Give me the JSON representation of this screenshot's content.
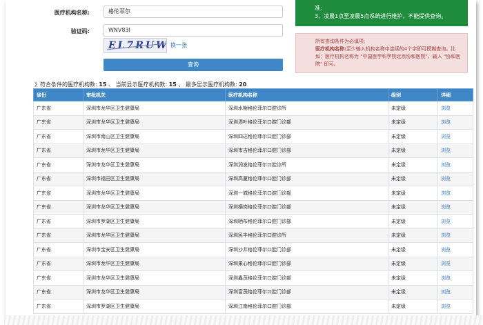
{
  "form": {
    "name_label": "医疗机构名称:",
    "name_value": "格伦菲尔",
    "code_label": "验证码:",
    "code_value": "WNV83I",
    "captcha_text": "EL7RUW",
    "refresh_label": "换一张",
    "query_label": "查询"
  },
  "notices": {
    "green_line1": "准;",
    "green_line2": "3、凌晨1点至凌晨5点系统进行维护，不能提供查询。",
    "red_line1": "所有查询条件为必填项;",
    "red_bold": "医疗机构名称:",
    "red_line2": "至少输入机构名称中连续的4个字即可模糊查询。比如：医疗机构名称为 \"中国医学科学院北京协和医院\"，输入 \"协和医院\" 即可。"
  },
  "summary": {
    "prefix": "》符合条件的医疗机构数:",
    "matched": "15",
    "mid": "、 当前显示医疗机构数:",
    "shown": "15",
    "mid2": "、 最多显示医疗机构数:",
    "max": "20"
  },
  "table": {
    "headers": [
      "省份",
      "审批机关",
      "医疗机构名称",
      "级别",
      "详细"
    ],
    "rows": [
      [
        "广东省",
        "深圳市龙华区卫生健康局",
        "深圳水榭格伦菲尔口腔诊所",
        "未定级",
        "浏览"
      ],
      [
        "广东省",
        "深圳市龙华区卫生健康局",
        "深圳漂叶格伦菲尔口腔门诊部",
        "未定级",
        "浏览"
      ],
      [
        "广东省",
        "深圳市南山区卫生健康局",
        "深圳四达格伦菲尔口腔门诊部",
        "未定级",
        "浏览"
      ],
      [
        "广东省",
        "深圳市龙华区卫生健康局",
        "深圳市吉格伦菲尔口腔门诊部",
        "未定级",
        "浏览"
      ],
      [
        "广东省",
        "深圳市龙华区卫生健康局",
        "深圳润发格伦菲尔口腔诊所",
        "未定级",
        "浏览"
      ],
      [
        "广东省",
        "深圳市福田区卫生健康局",
        "深圳高厦格伦菲尔口腔门诊部",
        "未定级",
        "浏览"
      ],
      [
        "广东省",
        "深圳市龙华区卫生健康局",
        "深圳一城格伦菲尔口腔门诊部",
        "未定级",
        "浏览"
      ],
      [
        "广东省",
        "深圳市龙华区卫生健康局",
        "深圳横岗格伦菲尔口腔门诊部",
        "未定级",
        "浏览"
      ],
      [
        "广东省",
        "深圳市罗湖区卫生健康局",
        "深圳晒布格伦菲尔口腔门诊部",
        "未定级",
        "浏览"
      ],
      [
        "广东省",
        "深圳市龙华区卫生健康局",
        "深圳民丰格伦菲尔口腔诊所",
        "未定级",
        "浏览"
      ],
      [
        "广东省",
        "深圳市宝安区卫生健康局",
        "深圳沙井格伦菲尔口腔门诊部",
        "未定级",
        "浏览"
      ],
      [
        "广东省",
        "深圳市龙华区卫生健康局",
        "深圳果心格伦菲尔口腔门诊部",
        "未定级",
        "浏览"
      ],
      [
        "广东省",
        "深圳市龙华区卫生健康局",
        "深圳鑫茂格伦菲尔口腔门诊部",
        "未定级",
        "浏览"
      ],
      [
        "广东省",
        "深圳市龙华区卫生健康局",
        "深圳富茂格伦菲尔口腔门诊部",
        "未定级",
        "浏览"
      ],
      [
        "广东省",
        "深圳市罗湖区卫生健康局",
        "深圳江南格伦菲尔口腔门诊部",
        "未定级",
        "浏览"
      ]
    ]
  }
}
